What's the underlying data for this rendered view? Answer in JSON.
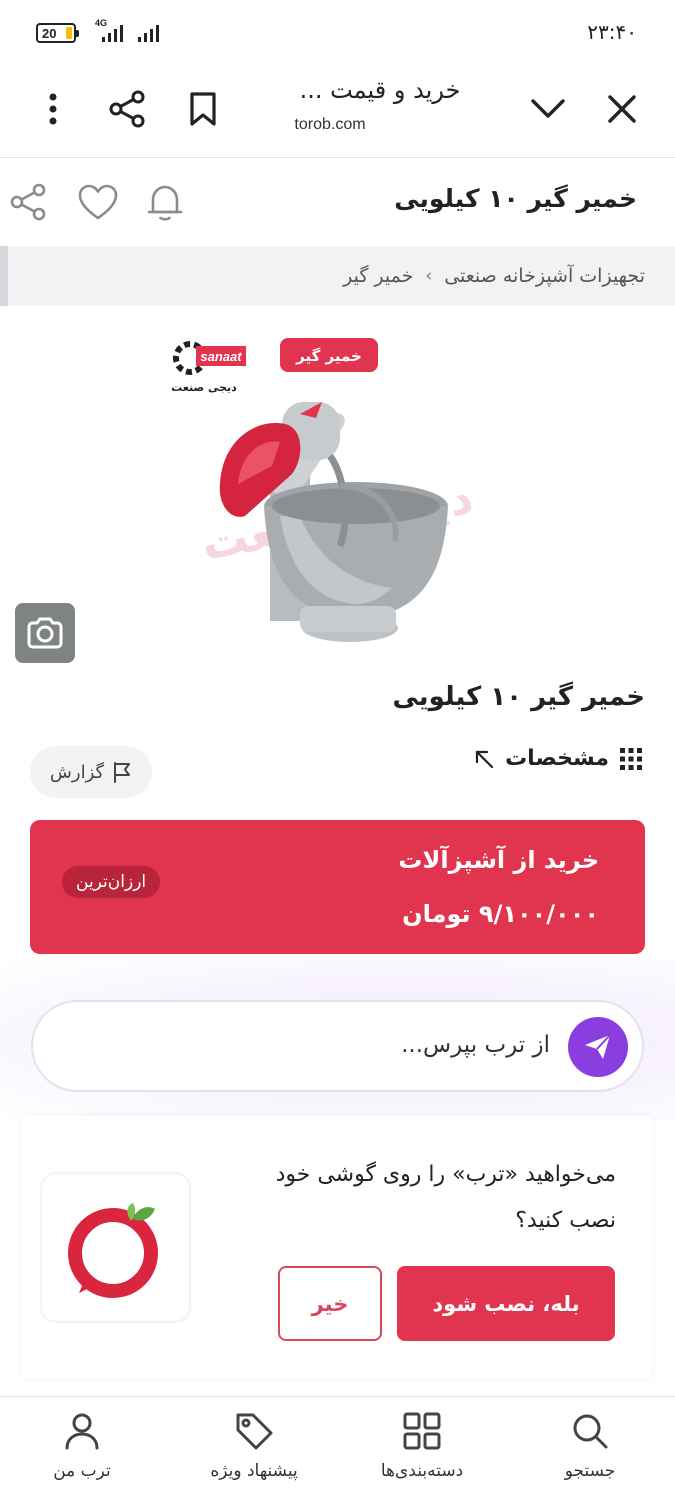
{
  "status_bar": {
    "battery": "20",
    "network": "4G",
    "clock": "۲۳:۴۰"
  },
  "browser": {
    "title": "خرید و قیمت ...",
    "url": "torob.com"
  },
  "product_header": {
    "title": "خمیر گیر ۱۰ کیلویی"
  },
  "breadcrumb": {
    "items": [
      "تجهیزات آشپزخانه صنعتی",
      "خمیر گیر"
    ],
    "separator": "›"
  },
  "product_image": {
    "logo_text": "sanaat",
    "logo_sub": "دیجی صنعت",
    "tag": "خمیر گیر"
  },
  "product": {
    "name": "خمیر گیر ۱۰ کیلویی",
    "specs_label": "مشخصات",
    "report_label": "گزارش"
  },
  "offer": {
    "title": "خرید از آشپزآلات",
    "price": "۹/۱۰۰/۰۰۰ تومان",
    "badge": "ارزان‌ترین"
  },
  "ask": {
    "placeholder": "از ترب بپرس..."
  },
  "install_prompt": {
    "text": "می‌خواهید «ترب» را روی گوشی خود نصب کنید؟",
    "yes": "بله، نصب شود",
    "no": "خیر"
  },
  "bottom_nav": [
    {
      "label": "جستجو",
      "icon": "search-icon"
    },
    {
      "label": "دسته‌بندی‌ها",
      "icon": "grid-icon"
    },
    {
      "label": "پیشنهاد ویژه",
      "icon": "tag-icon"
    },
    {
      "label": "ترب من",
      "icon": "user-icon"
    }
  ],
  "colors": {
    "accent_red": "#e0344f",
    "ask_purple": "#8a3ee0"
  }
}
